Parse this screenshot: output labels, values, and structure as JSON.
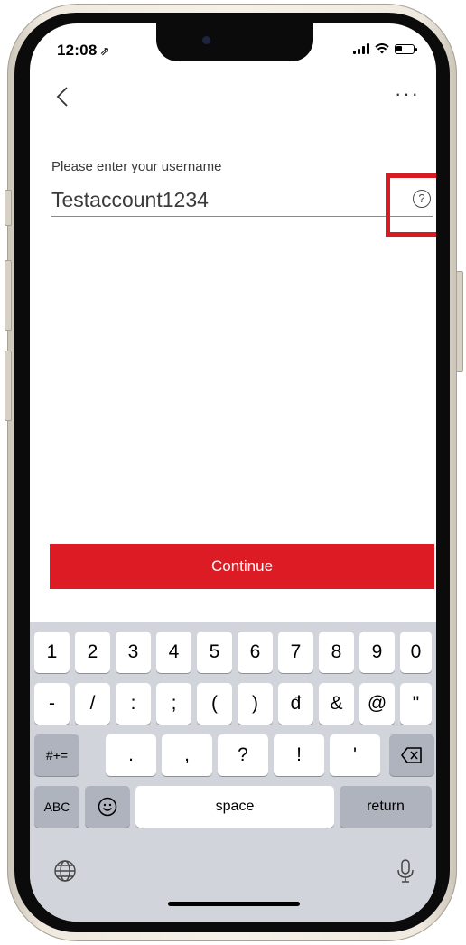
{
  "status_bar": {
    "time": "12:08",
    "location_glyph": "⇗"
  },
  "nav": {
    "more_label": "···"
  },
  "form": {
    "prompt": "Please enter your username",
    "username_value": "Testaccount1234",
    "help_glyph": "?"
  },
  "primary_button": {
    "label": "Continue",
    "color": "#dc1b24"
  },
  "highlight_color": "#d51b24",
  "keyboard": {
    "row1": [
      "1",
      "2",
      "3",
      "4",
      "5",
      "6",
      "7",
      "8",
      "9",
      "0"
    ],
    "row2": [
      "-",
      "/",
      ":",
      ";",
      "(",
      ")",
      "đ",
      "&",
      "@",
      "\""
    ],
    "row3_mode": "#+=",
    "row3": [
      ".",
      ",",
      "?",
      "!",
      "'"
    ],
    "abc": "ABC",
    "space": "space",
    "return": "return"
  }
}
